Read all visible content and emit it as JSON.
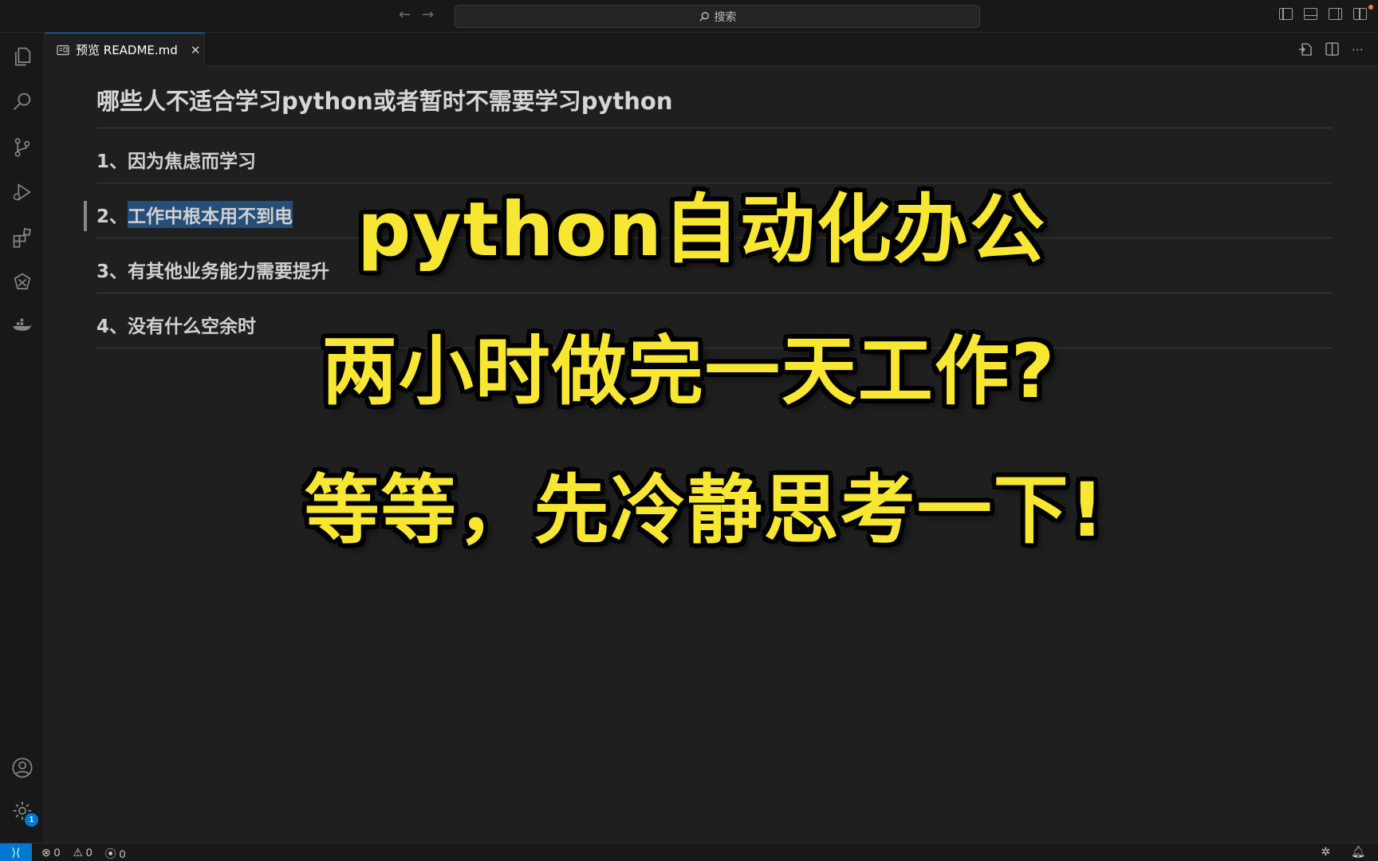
{
  "titlebar": {
    "back_icon": "←",
    "forward_icon": "→",
    "search_label": "搜索"
  },
  "tab": {
    "label": "预览 README.md",
    "close": "✕"
  },
  "document": {
    "title": "哪些人不适合学习python或者暂时不需要学习python",
    "items": [
      {
        "prefix": "1、",
        "text": "因为焦虑而学习"
      },
      {
        "prefix": "2、",
        "text": "工作中根本用不到电"
      },
      {
        "prefix": "3、",
        "text": "有其他业务能力需要提升"
      },
      {
        "prefix": "4、",
        "text": "没有什么空余时"
      }
    ]
  },
  "overlay": {
    "line1": "python自动化办公",
    "line2": "两小时做完一天工作?",
    "line3": "等等，先冷静思考一下!"
  },
  "statusbar": {
    "remote_icon": "⟩⟨",
    "errors": "0",
    "warnings": "0",
    "ports": "0"
  },
  "settings_badge": "1",
  "colors": {
    "accent": "#0078d4",
    "caption_yellow": "#f7e733",
    "selection": "#264f78"
  }
}
